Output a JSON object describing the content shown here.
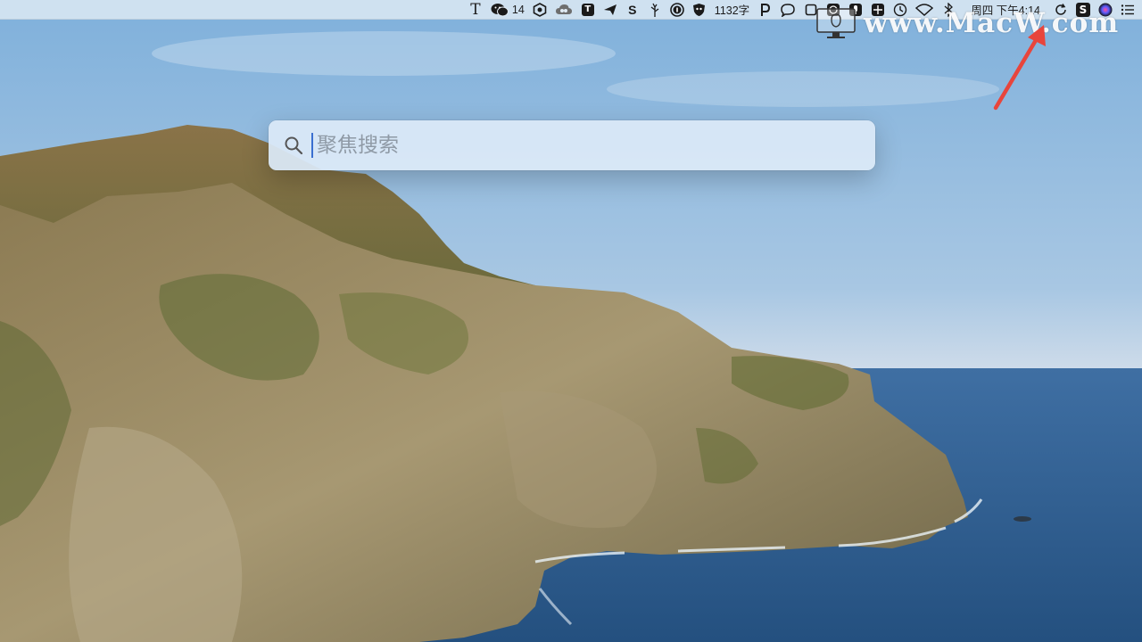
{
  "menubar": {
    "wechat_badge": "14",
    "word_count": "1132字",
    "clock": "周四 下午4:14"
  },
  "spotlight": {
    "placeholder": "聚焦搜索",
    "value": ""
  },
  "watermark": {
    "text": "www.MacW.com"
  },
  "icons": {
    "typora": "text-T-icon",
    "wechat": "wechat-icon",
    "hexagon": "hexagon-app-icon",
    "creative_cloud": "creative-cloud-icon",
    "t_box": "t-box-app-icon",
    "airplane": "send-plane-icon",
    "s_app": "s-app-icon",
    "tree": "tree-icon",
    "one_password": "one-password-icon",
    "bear_shield": "shield-icon",
    "paw": "p-icon",
    "chat": "chat-bubble-icon",
    "square": "square-icon",
    "face": "face-box-icon",
    "mic": "microphone-icon",
    "grid": "grid-box-icon",
    "time_machine": "time-machine-icon",
    "wifi": "wifi-icon",
    "bluetooth": "bluetooth-icon",
    "sync": "sync-icon",
    "s_box": "s-box-icon",
    "siri": "siri-icon",
    "notification": "notification-center-icon",
    "search": "search-icon",
    "watermark_logo": "macw-logo-icon",
    "arrow": "red-arrow-icon"
  },
  "colors": {
    "arrow": "#e8453c",
    "caret": "#3a6fd0"
  }
}
